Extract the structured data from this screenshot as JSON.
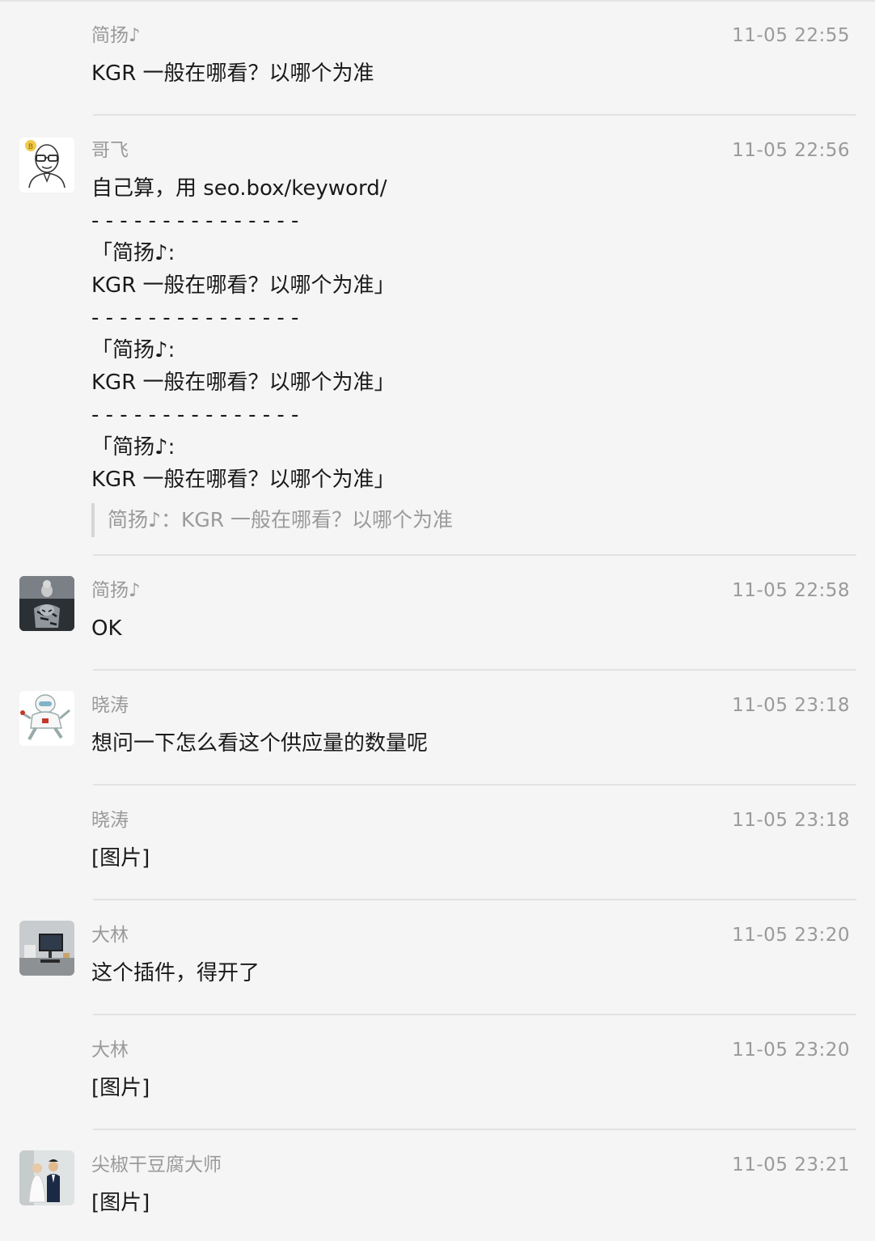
{
  "messages": [
    {
      "sender": "简扬♪",
      "time": "11-05 22:55",
      "text": "KGR 一般在哪看？以哪个为准",
      "avatar": null
    },
    {
      "sender": "哥飞",
      "time": "11-05 22:56",
      "text": "自己算，用 seo.box/keyword/\n- - - - - - - - - - - - - - -\n「简扬♪:\nKGR 一般在哪看？以哪个为准」\n- - - - - - - - - - - - - - -\n「简扬♪:\nKGR 一般在哪看？以哪个为准」\n- - - - - - - - - - - - - - -\n「简扬♪:\nKGR 一般在哪看？以哪个为准」",
      "quote": "简扬♪：KGR 一般在哪看？以哪个为准",
      "avatar": "cartoon-glasses-man-avatar"
    },
    {
      "sender": "简扬♪",
      "time": "11-05 22:58",
      "text": "OK",
      "avatar": "cat-tiger-reflection-avatar"
    },
    {
      "sender": "晓涛",
      "time": "11-05 23:18",
      "text": "想问一下怎么看这个供应量的数量呢",
      "avatar": "astronaut-cartoon-avatar"
    },
    {
      "sender": "晓涛",
      "time": "11-05 23:18",
      "text": "[图片]",
      "avatar": null
    },
    {
      "sender": "大林",
      "time": "11-05 23:20",
      "text": "这个插件，得开了",
      "avatar": "desk-setup-avatar"
    },
    {
      "sender": "大林",
      "time": "11-05 23:20",
      "text": "[图片]",
      "avatar": null
    },
    {
      "sender": "尖椒干豆腐大师",
      "time": "11-05 23:21",
      "text": "[图片]",
      "avatar": "wedding-couple-avatar"
    }
  ]
}
